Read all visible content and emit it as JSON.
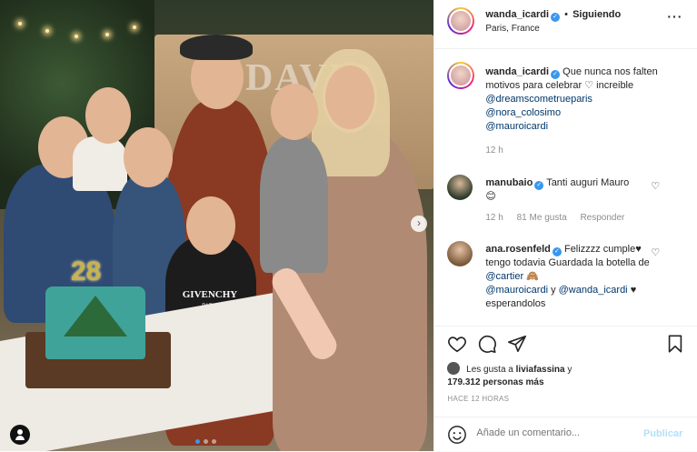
{
  "header": {
    "username": "wanda_icardi",
    "follow_status": "Siguiendo",
    "separator": "•",
    "location": "Paris, France",
    "more_icon": "more-horizontal-icon"
  },
  "caption": {
    "username": "wanda_icardi",
    "text_before": "Que nunca nos falten motivos para celebrar",
    "text_after": "increible",
    "mentions": [
      "@dreamscometrueparis",
      "@nora_colosimo",
      "@mauroicardi"
    ],
    "time": "12 h"
  },
  "comments": [
    {
      "username": "manubaio",
      "text": "Tanti auguri Mauro",
      "emoji": "😊",
      "time": "12 h",
      "likes": "81 Me gusta",
      "reply": "Responder"
    },
    {
      "username": "ana.rosenfeld",
      "text_1": "Felizzzz cumple",
      "text_2": "tengo todavia Guardada la botella de",
      "mention_1": "@cartier",
      "mention_2": "@mauroicardi",
      "connector": "y",
      "mention_3": "@wanda_icardi",
      "text_3": "esperandolos"
    }
  ],
  "likes": {
    "prefix": "Les gusta a",
    "user": "liviafassina",
    "connector": "y",
    "count": "179.312 personas más"
  },
  "post_time": "HACE 12 HORAS",
  "add_comment": {
    "placeholder": "Añade un comentario...",
    "publish_label": "Publicar"
  },
  "photo": {
    "cake_number": "28",
    "shirt_text": "GIVENCHY",
    "shirt_subtext": "PARIS",
    "sign_text": "DAVID"
  },
  "colors": {
    "link": "#00376b",
    "verified": "#3897f0",
    "publish_disabled": "#b2dffc"
  }
}
